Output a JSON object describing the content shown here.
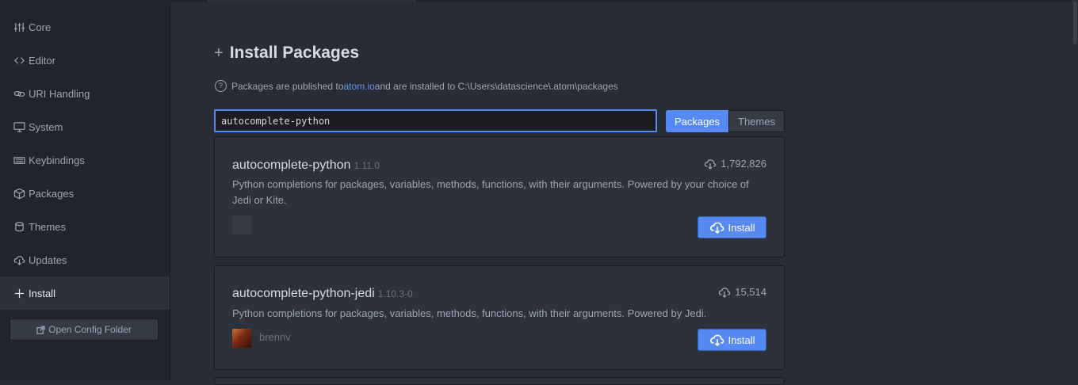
{
  "sidebar": {
    "items": [
      {
        "label": "Core",
        "icon": "sliders-icon"
      },
      {
        "label": "Editor",
        "icon": "code-icon"
      },
      {
        "label": "URI Handling",
        "icon": "link-icon"
      },
      {
        "label": "System",
        "icon": "monitor-icon"
      },
      {
        "label": "Keybindings",
        "icon": "keyboard-icon"
      },
      {
        "label": "Packages",
        "icon": "package-icon"
      },
      {
        "label": "Themes",
        "icon": "paintcan-icon"
      },
      {
        "label": "Updates",
        "icon": "cloud-download-icon"
      },
      {
        "label": "Install",
        "icon": "plus-icon"
      }
    ],
    "active": "Install",
    "config_button": "Open Config Folder"
  },
  "main": {
    "title": "Install Packages",
    "note": {
      "prefix": "Packages are published to ",
      "link": "atom.io",
      "suffix": " and are installed to C:\\Users\\datascience\\.atom\\packages"
    },
    "search": {
      "value": "autocomplete-python",
      "placeholder": ""
    },
    "toggle": {
      "packages_label": "Packages",
      "themes_label": "Themes",
      "selected": "Packages"
    },
    "results": [
      {
        "name": "autocomplete-python",
        "version": "1.11.0",
        "downloads": "1,792,826",
        "description": "Python completions for packages, variables, methods, functions, with their arguments. Powered by your choice of Jedi or Kite.",
        "author": "",
        "install_label": "Install"
      },
      {
        "name": "autocomplete-python-jedi",
        "version": "1.10.3-0",
        "downloads": "15,514",
        "description": "Python completions for packages, variables, methods, functions, with their arguments. Powered by Jedi.",
        "author": "brennv",
        "install_label": "Install"
      }
    ]
  },
  "colors": {
    "accent": "#568af2",
    "background": "#282c34",
    "sidebar": "#21252b",
    "card": "#2c313a"
  }
}
